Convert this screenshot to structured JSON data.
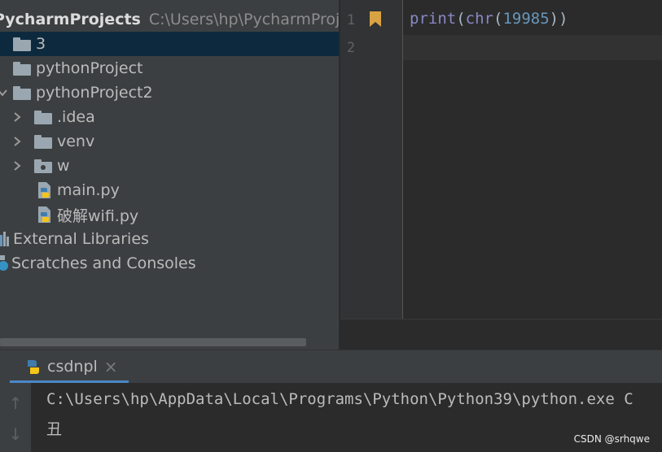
{
  "project_tree": {
    "root": {
      "name": "PycharmProjects",
      "path": "C:\\Users\\hp\\PycharmProj"
    },
    "items": [
      {
        "label": "3",
        "type": "folder",
        "selected": true
      },
      {
        "label": "pythonProject",
        "type": "folder"
      },
      {
        "label": "pythonProject2",
        "type": "folder",
        "expanded": true
      },
      {
        "label": ".idea",
        "type": "folder"
      },
      {
        "label": "venv",
        "type": "folder"
      },
      {
        "label": "w",
        "type": "folder"
      },
      {
        "label": "main.py",
        "type": "python-file"
      },
      {
        "label": "破解wifi.py",
        "type": "python-file"
      },
      {
        "label": "External Libraries",
        "type": "library"
      },
      {
        "label": "Scratches and Consoles",
        "type": "scratches"
      }
    ]
  },
  "editor": {
    "line_numbers": [
      "1",
      "2"
    ],
    "code_tokens": {
      "fn1": "print",
      "p1": "(",
      "fn2": "chr",
      "p2": "(",
      "num": "19985",
      "p3": "))"
    }
  },
  "run_panel": {
    "tab_label": "csdnpl",
    "close_symbol": "×",
    "console_lines": [
      "C:\\Users\\hp\\AppData\\Local\\Programs\\Python\\Python39\\python.exe C",
      "丑"
    ]
  },
  "watermark": "CSDN @srhqwe",
  "colors": {
    "accent": "#4a88c7",
    "selection": "#0d293e",
    "bookmark": "#d9a343",
    "python_blue": "#3f7cac",
    "python_yellow": "#f5c518"
  }
}
